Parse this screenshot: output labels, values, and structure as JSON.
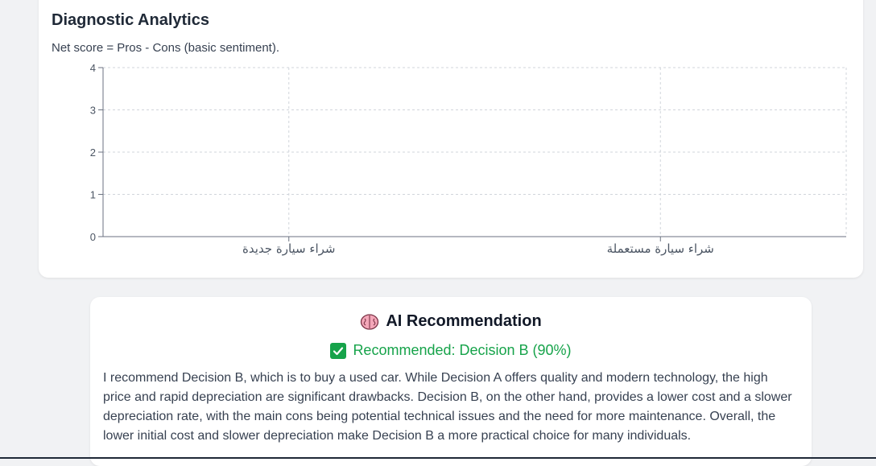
{
  "analytics": {
    "title": "Diagnostic Analytics",
    "subtitle": "Net score = Pros - Cons (basic sentiment)."
  },
  "chart_data": {
    "type": "bar",
    "categories": [
      "شراء سيارة جديدة",
      "شراء سيارة مستعملة"
    ],
    "values": [
      0,
      0
    ],
    "title": "",
    "xlabel": "",
    "ylabel": "",
    "ylim": [
      0,
      4
    ],
    "yticks": [
      0,
      1,
      2,
      3,
      4
    ],
    "grid": true,
    "colors": {
      "grid": "#d1d5db",
      "axis": "#6b7280",
      "tick_text": "#4b5563"
    }
  },
  "recommendation": {
    "icon": "brain-icon",
    "title": "AI Recommendation",
    "decision_icon": "check-icon",
    "decision": "Recommended: Decision B (90%)",
    "body": "I recommend Decision B, which is to buy a used car. While Decision A offers quality and modern technology, the high price and rapid depreciation are significant drawbacks. Decision B, on the other hand, provides a lower cost and a slower depreciation rate, with the main cons being potential technical issues and the need for more maintenance. Overall, the lower initial cost and slower depreciation make Decision B a more practical choice for many individuals.",
    "accent_color": "#16a34a"
  }
}
